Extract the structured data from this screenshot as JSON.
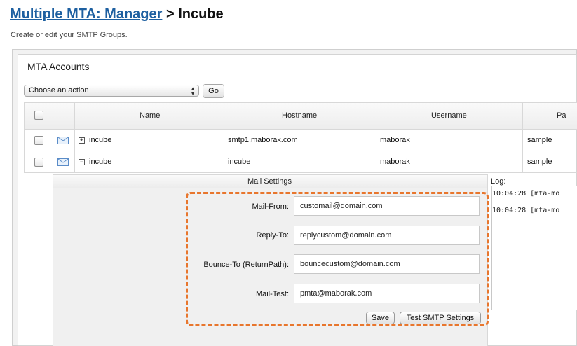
{
  "header": {
    "breadcrumb_link": "Multiple MTA: Manager",
    "separator": ">",
    "current": "Incube",
    "subtitle": "Create or edit your SMTP Groups."
  },
  "panel": {
    "title": "MTA Accounts"
  },
  "actions": {
    "selected": "Choose an action",
    "go_label": "Go"
  },
  "table": {
    "columns": [
      "Name",
      "Hostname",
      "Username",
      "Pa"
    ],
    "rows": [
      {
        "expander": "+",
        "name": "incube",
        "hostname": "smtp1.maborak.com",
        "username": "maborak",
        "password": "sample"
      },
      {
        "expander": "−",
        "name": "incube",
        "hostname": "incube",
        "username": "maborak",
        "password": "sample"
      }
    ]
  },
  "mail_settings": {
    "title": "Mail Settings",
    "fields": [
      {
        "label": "Mail-From:",
        "value": "customail@domain.com"
      },
      {
        "label": "Reply-To:",
        "value": "replycustom@domain.com"
      },
      {
        "label": "Bounce-To (ReturnPath):",
        "value": "bouncecustom@domain.com"
      },
      {
        "label": "Mail-Test:",
        "value": "pmta@maborak.com"
      }
    ],
    "save_label": "Save",
    "test_label": "Test SMTP Settings"
  },
  "log": {
    "title": "Log:",
    "lines": [
      "10:04:28 [mta-mo",
      "10:04:28 [mta-mo"
    ]
  },
  "colors": {
    "accent": "#1d5fa0",
    "highlight": "#e8762d"
  }
}
